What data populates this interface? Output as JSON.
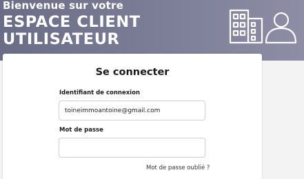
{
  "header": {
    "welcome_text": "Bienvenue sur votre",
    "title_line1": "ESPACE CLIENT",
    "title_line2": "UTILISATEUR",
    "icon": "buildings-user-icon"
  },
  "login_form": {
    "title": "Se connecter",
    "login_label": "Identifiant de connexion",
    "login_value": "toineimmoantoine@gmail.com",
    "password_label": "Mot de passe",
    "password_value": "",
    "forgot_password_link": "Mot de passe oublié ?"
  },
  "colors": {
    "banner": "#7a7b94",
    "page_background": "#f3f3f3",
    "card_background": "#ffffff"
  }
}
